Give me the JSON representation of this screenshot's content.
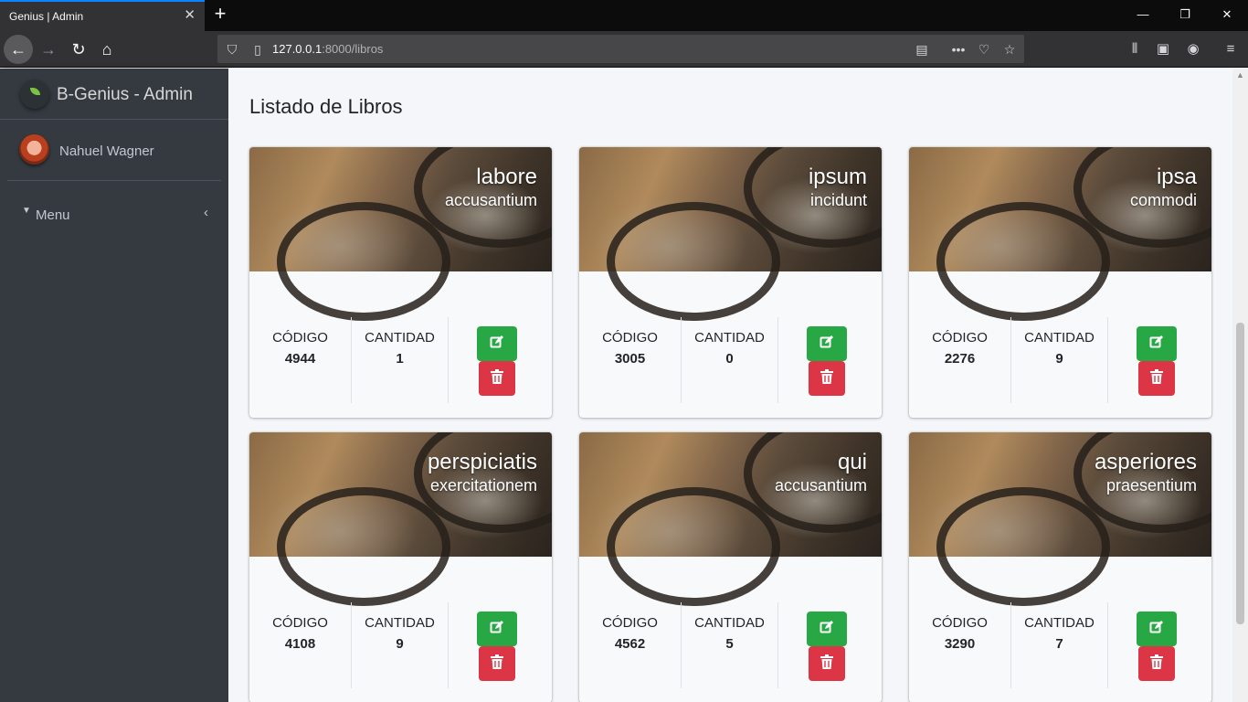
{
  "browser": {
    "tab_title": "Genius | Admin",
    "url_host": "127.0.0.1",
    "url_rest": ":8000/libros"
  },
  "sidebar": {
    "brand": "B-Genius - Admin",
    "user_name": "Nahuel Wagner",
    "menu_label": "Menu"
  },
  "page": {
    "title": "Listado de Libros"
  },
  "labels": {
    "codigo": "CÓDIGO",
    "cantidad": "CANTIDAD"
  },
  "books": [
    {
      "title": "labore",
      "subtitle": "accusantium",
      "codigo": "4944",
      "cantidad": "1"
    },
    {
      "title": "ipsum",
      "subtitle": "incidunt",
      "codigo": "3005",
      "cantidad": "0"
    },
    {
      "title": "ipsa",
      "subtitle": "commodi",
      "codigo": "2276",
      "cantidad": "9"
    },
    {
      "title": "perspiciatis",
      "subtitle": "exercitationem",
      "codigo": "4108",
      "cantidad": "9"
    },
    {
      "title": "qui",
      "subtitle": "accusantium",
      "codigo": "4562",
      "cantidad": "5"
    },
    {
      "title": "asperiores",
      "subtitle": "praesentium",
      "codigo": "3290",
      "cantidad": "7"
    }
  ],
  "icons": {
    "edit": "edit-icon",
    "delete": "trash-icon"
  },
  "colors": {
    "edit_button": "#28a745",
    "delete_button": "#dc3545",
    "sidebar": "#343a40",
    "tab_accent": "#0a84ff"
  }
}
